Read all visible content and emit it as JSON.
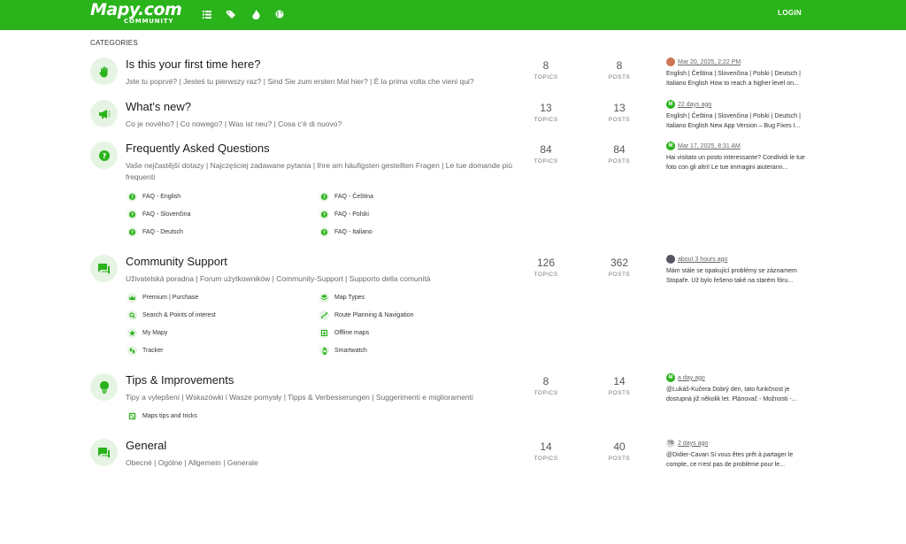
{
  "header": {
    "logo_main": "Mapy.com",
    "logo_sub": "COMMUNITY",
    "nav_icons": [
      "menu-icon",
      "tags-icon",
      "fire-icon",
      "globe-icon"
    ],
    "login_label": "LOGIN",
    "brand_color": "#2ab31b"
  },
  "page": {
    "heading": "CATEGORIES"
  },
  "categories": [
    {
      "name": "Is this your first time here?",
      "description": "Jste tu poprvé? | Jesteś tu pierwszy raz? | Sind Sie zum ersten Mal hier? | È la prima volta che vieni qui?",
      "topics": "8",
      "posts": "8",
      "topics_label": "TOPICS",
      "posts_label": "POSTS",
      "latest": {
        "date": "Mar 20, 2025, 2:22 PM",
        "text": "English | Čeština | Slovenčina | Polski | Deutsch | Italiano English How to reach a higher level on..."
      },
      "icon": "hand-wave-icon",
      "subcategories": []
    },
    {
      "name": "What's new?",
      "description": "Co je nového? | Co nowego? | Was ist neu? | Cosa c'è di nuovo?",
      "topics": "13",
      "posts": "13",
      "topics_label": "TOPICS",
      "posts_label": "POSTS",
      "latest": {
        "date": "22 days ago",
        "text": "English | Čeština | Slovenčina | Polski | Deutsch | Italiano English New App Version – Bug Fixes I..."
      },
      "icon": "megaphone-icon",
      "subcategories": []
    },
    {
      "name": "Frequently Asked Questions",
      "description": "Vaše nejčastější dotazy | Najczęściej zadawane pytania | Ihre am häufigsten gestellten Fragen | Le tue domande più frequenti",
      "topics": "84",
      "posts": "84",
      "topics_label": "TOPICS",
      "posts_label": "POSTS",
      "latest": {
        "date": "Mar 17, 2025, 8:31 AM",
        "text": "Hai visitato un posto interessante? Condividi le tue foto con gli altri! Le tue immagini aiuterann..."
      },
      "icon": "question-icon",
      "subcategories": [
        {
          "label": "FAQ - English",
          "icon": "question-icon"
        },
        {
          "label": "FAQ - Čeština",
          "icon": "question-icon"
        },
        {
          "label": "FAQ - Slovenčina",
          "icon": "question-icon"
        },
        {
          "label": "FAQ - Polski",
          "icon": "question-icon"
        },
        {
          "label": "FAQ - Deutsch",
          "icon": "question-icon"
        },
        {
          "label": "FAQ - Italiano",
          "icon": "question-icon"
        }
      ]
    },
    {
      "name": "Community Support",
      "description": "Uživatelská poradna | Forum użytkowników | Community-Support | Supporto della comunità",
      "topics": "126",
      "posts": "362",
      "topics_label": "TOPICS",
      "posts_label": "POSTS",
      "latest": {
        "date": "about 3 hours ago",
        "text": "Mám stále se opakující problémy se záznamem Stopaře. Už bylo řešeno také na starém fóru..."
      },
      "icon": "chat-icon",
      "subcategories": [
        {
          "label": "Premium | Purchase",
          "icon": "crown-icon"
        },
        {
          "label": "Map Types",
          "icon": "layers-icon"
        },
        {
          "label": "Search & Points of interest",
          "icon": "search-icon"
        },
        {
          "label": "Route Planning & Navigation",
          "icon": "route-icon"
        },
        {
          "label": "My Mapy",
          "icon": "star-icon"
        },
        {
          "label": "Offline maps",
          "icon": "offline-map-icon"
        },
        {
          "label": "Tracker",
          "icon": "footprint-icon"
        },
        {
          "label": "Smartwatch",
          "icon": "watch-icon"
        }
      ]
    },
    {
      "name": "Tips & Improvements",
      "description": "Tipy a vylepšení | Wskazówki i Wasze pomysły | Tipps & Verbesserungen | Suggerimenti e miglioramenti",
      "topics": "8",
      "posts": "14",
      "topics_label": "TOPICS",
      "posts_label": "POSTS",
      "latest": {
        "date": "a day ago",
        "text": "@Lukáš-Kučera Dobrý den, tato funkčnost je dostupná již několik let. Plánovač - Možnosti -..."
      },
      "icon": "lightbulb-icon",
      "subcategories": [
        {
          "label": "Maps tips and tricks",
          "icon": "map-icon"
        }
      ]
    },
    {
      "name": "General",
      "description": "Obecné | Ogólne | Allgemein | Generale",
      "topics": "14",
      "posts": "40",
      "topics_label": "TOPICS",
      "posts_label": "POSTS",
      "latest": {
        "date": "2 days ago",
        "text": "@Didier-Cavan Si vous êtes prêt à partager le compte, ce n'est pas de problème pour le..."
      },
      "icon": "chat-icon",
      "subcategories": []
    }
  ],
  "avatar_initials": {
    "user_tb": "TB"
  }
}
